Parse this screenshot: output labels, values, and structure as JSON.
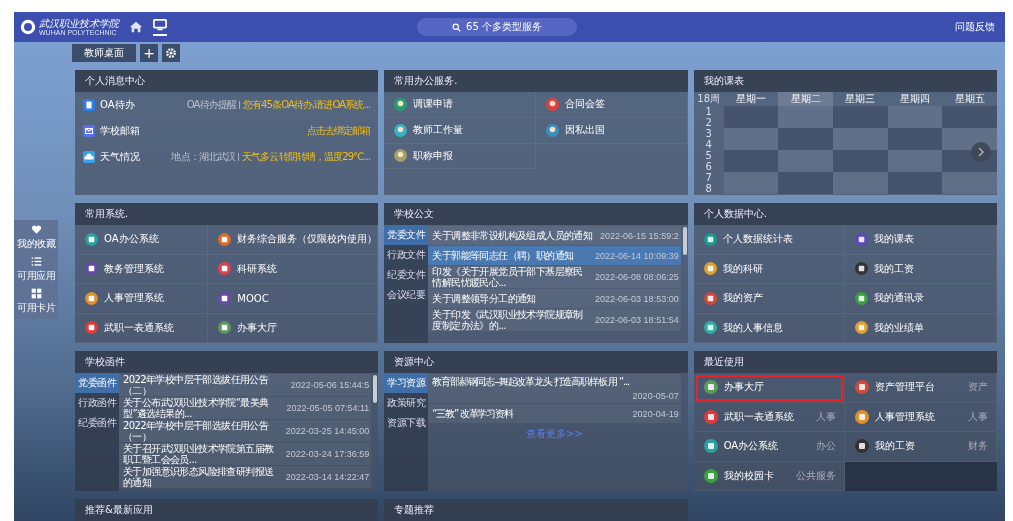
{
  "header": {
    "logo_cn": "武汉职业技术学院",
    "logo_en": "WUHAN POLYTECHNIC",
    "search": "65 个多类型服务",
    "feedback": "问题反馈"
  },
  "desk_tabs": [
    {
      "label": "教师桌面",
      "selected": true
    }
  ],
  "add_tab": "+",
  "side_dock": [
    {
      "label": "我的收藏",
      "kind": "heart"
    },
    {
      "label": "可用应用",
      "kind": "list"
    },
    {
      "label": "可用卡片",
      "kind": "grid"
    }
  ],
  "messages": {
    "title": "个人消息中心",
    "items": [
      {
        "name": "OA待办",
        "kind": "doc",
        "color": "#2f7de1",
        "note": "OA待办提醒",
        "alert": "您有45条OA待办,请进OA系统..."
      },
      {
        "name": "学校邮箱",
        "kind": "mail",
        "color": "#5b6fe8",
        "alert": "点击去绑定邮箱"
      },
      {
        "name": "天气情况",
        "kind": "cloud",
        "color": "#35a3e8",
        "note": "地点：湖北武汉",
        "alert": "天气多云转阴转晴，温度29℃..."
      }
    ]
  },
  "office": {
    "title": "常用办公服务.",
    "items": [
      {
        "name": "调课申请",
        "color": "#2a9d6e"
      },
      {
        "name": "合同会签",
        "color": "#e04040"
      },
      {
        "name": "教师工作量",
        "color": "#3ab0c0"
      },
      {
        "name": "因私出国",
        "color": "#3a8fc0"
      },
      {
        "name": "职称申报",
        "color": "#a0a060"
      }
    ]
  },
  "timetable": {
    "title": "我的课表",
    "week": "18周",
    "days": [
      {
        "label": "星期一",
        "selected": false
      },
      {
        "label": "星期二",
        "selected": true
      },
      {
        "label": "星期三",
        "selected": false
      },
      {
        "label": "星期四",
        "selected": false
      },
      {
        "label": "星期五",
        "selected": false
      }
    ],
    "periods": [
      "1",
      "2",
      "3",
      "4",
      "5",
      "6",
      "7",
      "8"
    ]
  },
  "systems": {
    "title": "常用系统.",
    "items": [
      {
        "name": "OA办公系统",
        "color": "#2aa0a0"
      },
      {
        "name": "财务综合服务（仅限校内使用）",
        "color": "#e06a2a"
      },
      {
        "name": "教务管理系统",
        "color": "#6a4aa8"
      },
      {
        "name": "科研系统",
        "color": "#e04050"
      },
      {
        "name": "人事管理系统",
        "color": "#e0902a"
      },
      {
        "name": "MOOC",
        "color": "#6a4aa8"
      },
      {
        "name": "武职一表通系统",
        "color": "#e03a3a"
      },
      {
        "name": "办事大厅",
        "color": "#5a9a5a"
      }
    ]
  },
  "documents": {
    "title": "学校公文",
    "tabs": [
      {
        "label": "党委文件",
        "selected": true
      },
      {
        "label": "行政文件",
        "selected": false
      },
      {
        "label": "纪委文件",
        "selected": false
      },
      {
        "label": "会议纪要",
        "selected": false
      }
    ],
    "rows": [
      {
        "title": "关于调整非常设机构及组成人员的通知",
        "time": "2022-06-15 15:59:2",
        "selected": false
      },
      {
        "title": "关于郭能等同志任（聘）职的通知",
        "time": "2022-06-14 10:09:39",
        "selected": true
      },
      {
        "title": "印发《关于开展党员干部下基层察民情解民忧暖民心...",
        "time": "2022-06-08 08:06:25",
        "selected": false
      },
      {
        "title": "关于调整领导分工的通知",
        "time": "2022-06-03 18:53:00",
        "selected": false
      },
      {
        "title": "关于印发《武汉职业技术学院规章制度制定办法》的...",
        "time": "2022-06-03 18:51:54",
        "selected": false
      }
    ]
  },
  "data_center": {
    "title": "个人数据中心.",
    "items": [
      {
        "name": "个人数据统计表",
        "color": "#1a9a8a"
      },
      {
        "name": "我的课表",
        "color": "#5a4ab8"
      },
      {
        "name": "我的科研",
        "color": "#e0a030"
      },
      {
        "name": "我的工资",
        "color": "#333333"
      },
      {
        "name": "我的资产",
        "color": "#d04a3a"
      },
      {
        "name": "我的通讯录",
        "color": "#3aa040"
      },
      {
        "name": "我的人事信息",
        "color": "#2ab0a0"
      },
      {
        "name": "我的业绩单",
        "color": "#e0a030"
      }
    ]
  },
  "letters": {
    "title": "学校函件",
    "tabs": [
      {
        "label": "党委函件",
        "selected": true
      },
      {
        "label": "行政函件",
        "selected": false
      },
      {
        "label": "纪委函件",
        "selected": false
      }
    ],
    "rows": [
      {
        "title": "2022年学校中层干部选拔任用公告（二）",
        "time": "2022-05-06 15:44:5"
      },
      {
        "title": "关于公布武汉职业技术学院“最美典型”遴选结果的...",
        "time": "2022-05-05 07:54:11"
      },
      {
        "title": "2022年学校中层干部选拔任用公告（一）",
        "time": "2022-03-25 14:45:00"
      },
      {
        "title": "关于召开武汉职业技术学院第五届教职工暨工会会员...",
        "time": "2022-03-24 17:36:59"
      },
      {
        "title": "关于加强意识形态风险排查研判报送的通知",
        "time": "2022-03-14 14:22:47"
      }
    ]
  },
  "resources": {
    "title": "资源中心",
    "tabs": [
      {
        "label": "学习资源",
        "selected": true
      },
      {
        "label": "政策研究",
        "selected": false
      },
      {
        "label": "资源下载",
        "selected": false
      }
    ],
    "rows": [
      {
        "title": "教育部郝钢同志--舞起改革龙头 打造高职样板 用 “...",
        "time": "2020-05-07"
      },
      {
        "title": "“三教” 改革学习资料",
        "time": "2020-04-19"
      }
    ],
    "more": "查看更多>>"
  },
  "recent": {
    "title": "最近使用",
    "items": [
      {
        "name": "办事大厅",
        "color": "#5a9a5a",
        "marked": true
      },
      {
        "name": "资产管理平台",
        "tag": "资产",
        "color": "#d04a3a",
        "marked": false
      },
      {
        "name": "武职一表通系统",
        "tag": "人事",
        "color": "#e03a3a",
        "marked": false
      },
      {
        "name": "人事管理系统",
        "tag": "人事",
        "color": "#e0902a",
        "marked": false
      },
      {
        "name": "OA办公系统",
        "tag": "办公",
        "color": "#2aa0a0",
        "marked": false
      },
      {
        "name": "我的工资",
        "tag": "财务",
        "color": "#333333",
        "marked": false
      },
      {
        "name": "我的校园卡",
        "tag": "公共服务",
        "color": "#3aa040",
        "marked": false
      }
    ]
  },
  "bottom_panels": [
    "推荐&最新应用",
    "专题推荐"
  ]
}
